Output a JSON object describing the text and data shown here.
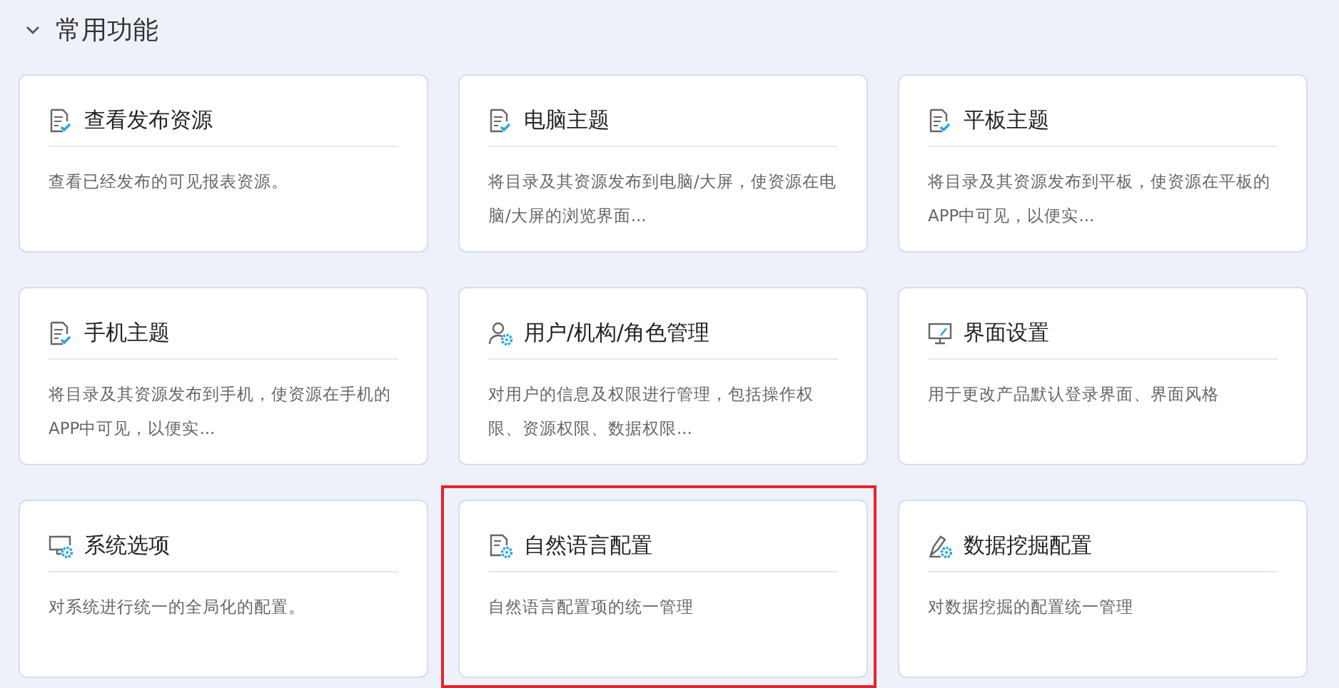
{
  "section": {
    "title": "常用功能",
    "expanded": true,
    "cards": [
      {
        "title": "查看发布资源",
        "description": "查看已经发布的可见报表资源。",
        "highlighted": false
      },
      {
        "title": "电脑主题",
        "description": "将目录及其资源发布到电脑/大屏，使资源在电脑/大屏的浏览界面...",
        "highlighted": false
      },
      {
        "title": "平板主题",
        "description": "将目录及其资源发布到平板，使资源在平板的APP中可见，以便实...",
        "highlighted": false
      },
      {
        "title": "手机主题",
        "description": "将目录及其资源发布到手机，使资源在手机的APP中可见，以便实...",
        "highlighted": false
      },
      {
        "title": "用户/机构/角色管理",
        "description": "对用户的信息及权限进行管理，包括操作权限、资源权限、数据权限...",
        "highlighted": false
      },
      {
        "title": "界面设置",
        "description": "用于更改产品默认登录界面、界面风格",
        "highlighted": false
      },
      {
        "title": "系统选项",
        "description": "对系统进行统一的全局化的配置。",
        "highlighted": false
      },
      {
        "title": "自然语言配置",
        "description": "自然语言配置项的统一管理",
        "highlighted": true
      },
      {
        "title": "数据挖掘配置",
        "description": "对数据挖掘的配置统一管理",
        "highlighted": false
      }
    ]
  }
}
